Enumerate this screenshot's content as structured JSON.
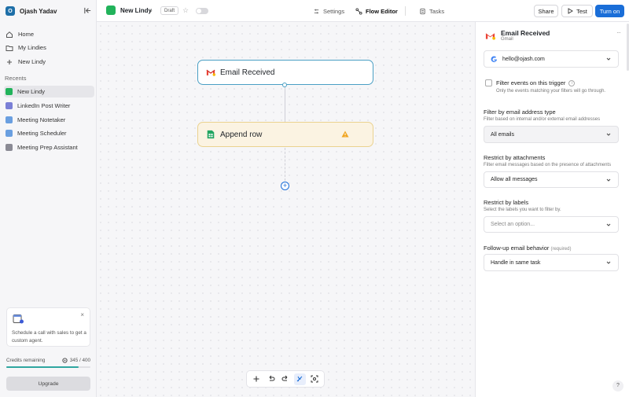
{
  "sidebar": {
    "user": {
      "initial": "O",
      "name": "Ojash Yadav"
    },
    "nav": [
      {
        "label": "Home",
        "icon": "home-icon"
      },
      {
        "label": "My Lindies",
        "icon": "folder-icon"
      },
      {
        "label": "New Lindy",
        "icon": "plus-icon"
      }
    ],
    "recents_title": "Recents",
    "recents": [
      {
        "label": "New Lindy",
        "color": "#22b35b",
        "active": true
      },
      {
        "label": "LinkedIn Post Writer",
        "color": "#7a7fd6",
        "active": false
      },
      {
        "label": "Meeting Notetaker",
        "color": "#6a9fe0",
        "active": false
      },
      {
        "label": "Meeting Scheduler",
        "color": "#6a9fe0",
        "active": false
      },
      {
        "label": "Meeting Prep Assistant",
        "color": "#8a8a94",
        "active": false
      }
    ],
    "promo": {
      "close": "×",
      "text": "Schedule a call with sales to get a custom agent."
    },
    "credits": {
      "label": "Credits remaining",
      "value": "345 / 400",
      "fraction": 0.8625
    },
    "upgrade": "Upgrade"
  },
  "topbar": {
    "flow_name": "New Lindy",
    "status": "Draft",
    "tabs": [
      {
        "label": "Settings",
        "icon": "gear-icon"
      },
      {
        "label": "Flow Editor",
        "icon": "flow-icon",
        "selected": true
      },
      {
        "label": "Tasks",
        "icon": "tasks-icon"
      }
    ],
    "share": "Share",
    "test": "Test",
    "turn_on": "Turn on"
  },
  "canvas": {
    "trigger": {
      "label": "Email Received",
      "icon": "gmail-icon"
    },
    "action": {
      "label": "Append row",
      "icon": "sheets-icon",
      "warning": true
    },
    "add_node": "+",
    "toolbar": [
      "add-icon",
      "undo-icon",
      "redo-icon",
      "auto-layout-icon",
      "fit-view-icon"
    ]
  },
  "panel": {
    "title": "Email Received",
    "subtitle": "Gmail",
    "more": "···",
    "account": "hello@ojash.com",
    "filter_checkbox": {
      "label": "Filter events on this trigger",
      "help": "Only the events matching your filters will go through.",
      "checked": false
    },
    "fields": [
      {
        "label": "Filter by email address type",
        "help": "Filter based on internal and/or external email addresses",
        "value": "All emails"
      },
      {
        "label": "Restrict by attachments",
        "help": "Filter email messages based on the presence of attachments",
        "value": "Allow all messages"
      },
      {
        "label": "Restrict by labels",
        "help": "Select the labels you want to filter by.",
        "placeholder": "Select an option..."
      },
      {
        "label": "Follow-up email behavior",
        "required": "(required)",
        "value": "Handle in same task"
      }
    ]
  },
  "help": "?",
  "colors": {
    "primary": "#1a6ed8",
    "trigger_border": "#4a9fc4",
    "action_bg": "#fbf3e2",
    "warning": "#f0a623"
  }
}
